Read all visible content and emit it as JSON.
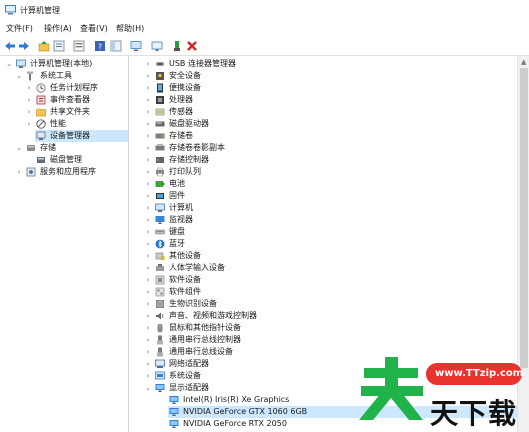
{
  "window": {
    "title": "计算机管理"
  },
  "menu": [
    "文件(F)",
    "操作(A)",
    "查看(V)",
    "帮助(H)"
  ],
  "toolbar": [
    "back-icon",
    "forward-icon",
    "up-folder-icon",
    "properties-icon",
    "list-view-icon",
    "help-icon",
    "show-hide-icon",
    "computer-icon",
    "update-driver-icon",
    "uninstall-icon"
  ],
  "left_tree": [
    {
      "label": "计算机管理(本地)",
      "icon": "computer",
      "indent": 0,
      "exp": "v"
    },
    {
      "label": "系统工具",
      "icon": "tools",
      "indent": 1,
      "exp": "v"
    },
    {
      "label": "任务计划程序",
      "icon": "clock",
      "indent": 2,
      "exp": ">"
    },
    {
      "label": "事件查看器",
      "icon": "event",
      "indent": 2,
      "exp": ">"
    },
    {
      "label": "共享文件夹",
      "icon": "folder",
      "indent": 2,
      "exp": ">"
    },
    {
      "label": "性能",
      "icon": "perf",
      "indent": 2,
      "exp": ">"
    },
    {
      "label": "设备管理器",
      "icon": "devmgr",
      "indent": 2,
      "exp": "",
      "selected": true
    },
    {
      "label": "存储",
      "icon": "storage",
      "indent": 1,
      "exp": "v"
    },
    {
      "label": "磁盘管理",
      "icon": "disk",
      "indent": 2,
      "exp": ""
    },
    {
      "label": "服务和应用程序",
      "icon": "services",
      "indent": 1,
      "exp": ">"
    }
  ],
  "device_tree": [
    {
      "label": "USB 连接器管理器",
      "icon": "usb",
      "indent": 0,
      "exp": ">"
    },
    {
      "label": "安全设备",
      "icon": "security",
      "indent": 0,
      "exp": ">"
    },
    {
      "label": "便携设备",
      "icon": "portable",
      "indent": 0,
      "exp": ">"
    },
    {
      "label": "处理器",
      "icon": "cpu",
      "indent": 0,
      "exp": ">"
    },
    {
      "label": "传感器",
      "icon": "sensor",
      "indent": 0,
      "exp": ">"
    },
    {
      "label": "磁盘驱动器",
      "icon": "drive",
      "indent": 0,
      "exp": ">"
    },
    {
      "label": "存储卷",
      "icon": "volume",
      "indent": 0,
      "exp": ">"
    },
    {
      "label": "存储卷卷影副本",
      "icon": "shadow",
      "indent": 0,
      "exp": ">"
    },
    {
      "label": "存储控制器",
      "icon": "storctl",
      "indent": 0,
      "exp": ">"
    },
    {
      "label": "打印队列",
      "icon": "printer",
      "indent": 0,
      "exp": ">"
    },
    {
      "label": "电池",
      "icon": "battery",
      "indent": 0,
      "exp": ">"
    },
    {
      "label": "固件",
      "icon": "firmware",
      "indent": 0,
      "exp": ">"
    },
    {
      "label": "计算机",
      "icon": "computer",
      "indent": 0,
      "exp": ">"
    },
    {
      "label": "监视器",
      "icon": "monitor",
      "indent": 0,
      "exp": ">"
    },
    {
      "label": "键盘",
      "icon": "keyboard",
      "indent": 0,
      "exp": ">"
    },
    {
      "label": "蓝牙",
      "icon": "bluetooth",
      "indent": 0,
      "exp": ">"
    },
    {
      "label": "其他设备",
      "icon": "other",
      "indent": 0,
      "exp": ">"
    },
    {
      "label": "人体学输入设备",
      "icon": "hid",
      "indent": 0,
      "exp": ">"
    },
    {
      "label": "软件设备",
      "icon": "softdev",
      "indent": 0,
      "exp": ">"
    },
    {
      "label": "软件组件",
      "icon": "softcomp",
      "indent": 0,
      "exp": ">"
    },
    {
      "label": "生物识别设备",
      "icon": "biometric",
      "indent": 0,
      "exp": ">"
    },
    {
      "label": "声音、视频和游戏控制器",
      "icon": "sound",
      "indent": 0,
      "exp": ">"
    },
    {
      "label": "鼠标和其他指针设备",
      "icon": "mouse",
      "indent": 0,
      "exp": ">"
    },
    {
      "label": "通用串行总线控制器",
      "icon": "usbctl",
      "indent": 0,
      "exp": ">"
    },
    {
      "label": "通用串行总线设备",
      "icon": "usbdev",
      "indent": 0,
      "exp": ">"
    },
    {
      "label": "网络适配器",
      "icon": "network",
      "indent": 0,
      "exp": ">"
    },
    {
      "label": "系统设备",
      "icon": "system",
      "indent": 0,
      "exp": ">"
    },
    {
      "label": "显示适配器",
      "icon": "display",
      "indent": 0,
      "exp": "v"
    },
    {
      "label": "Intel(R) Iris(R) Xe Graphics",
      "icon": "display",
      "indent": 1,
      "exp": ""
    },
    {
      "label": "NVIDIA GeForce GTX 1060 6GB",
      "icon": "display",
      "indent": 1,
      "exp": "",
      "selected": true
    },
    {
      "label": "NVIDIA GeForce RTX 2050",
      "icon": "display",
      "indent": 1,
      "exp": ""
    }
  ],
  "watermark": {
    "brand_text": "天下载",
    "url": "www.TTzip.com"
  },
  "colors": {
    "selection": "#cce8ff",
    "watermark_green": "#1fb34a",
    "watermark_red": "#e8322d"
  }
}
